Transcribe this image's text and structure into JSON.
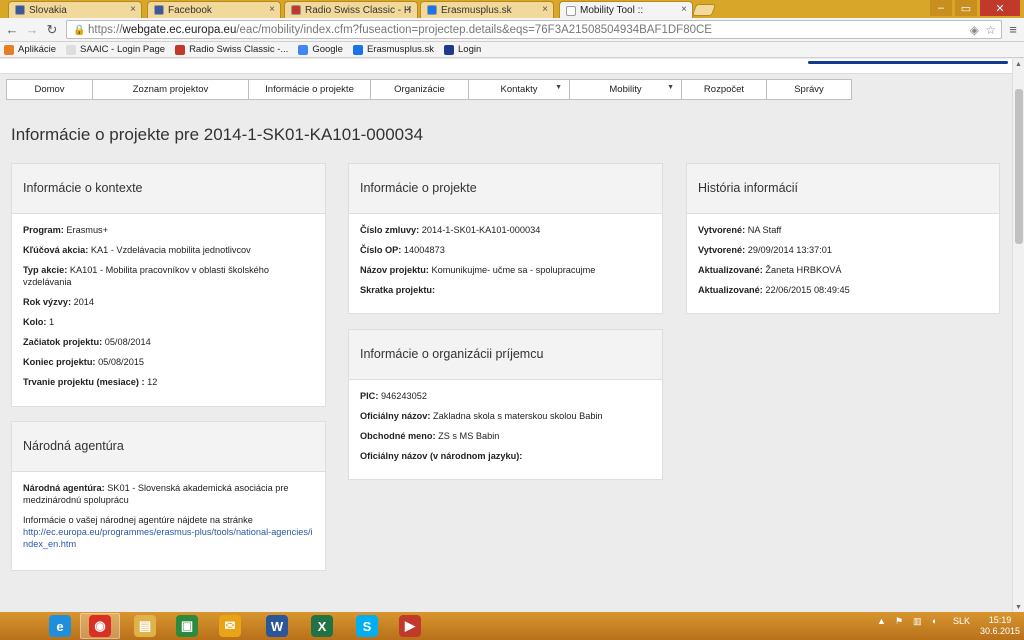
{
  "tabs": [
    {
      "label": "Slovakia",
      "color": "#3b5998"
    },
    {
      "label": "Facebook",
      "color": "#3b5998"
    },
    {
      "label": "Radio Swiss Classic - H",
      "color": "#c0392b"
    },
    {
      "label": "Erasmusplus.sk",
      "color": "#1a73e8"
    },
    {
      "label": "Mobility Tool ::",
      "color": "#ffffff"
    }
  ],
  "address": {
    "scheme": "https://",
    "host": "webgate.ec.europa.eu",
    "path": "/eac/mobility/index.cfm?fuseaction=projectep.details&eqs=76F3A21508504934BAF1DF80CE"
  },
  "bookmarks": [
    {
      "label": "Aplikácie",
      "icon": "apps-icon",
      "color": "#e67e22"
    },
    {
      "label": "SAAIC - Login Page",
      "icon": "page-icon",
      "color": "#dddddd"
    },
    {
      "label": "Radio Swiss Classic -...",
      "icon": "radio-icon",
      "color": "#c0392b"
    },
    {
      "label": "Google",
      "icon": "google-icon",
      "color": "#4285f4"
    },
    {
      "label": "Erasmusplus.sk",
      "icon": "erasmus-icon",
      "color": "#1a73e8"
    },
    {
      "label": "Login",
      "icon": "eu-icon",
      "color": "#1e3a8a"
    }
  ],
  "menu": [
    {
      "label": "Domov",
      "dropdown": false
    },
    {
      "label": "Zoznam projektov",
      "dropdown": false
    },
    {
      "label": "Informácie o projekte",
      "dropdown": false
    },
    {
      "label": "Organizácie",
      "dropdown": false
    },
    {
      "label": "Kontakty",
      "dropdown": true
    },
    {
      "label": "Mobility",
      "dropdown": true
    },
    {
      "label": "Rozpočet",
      "dropdown": false
    },
    {
      "label": "Správy",
      "dropdown": false
    }
  ],
  "page_title": "Informácie o projekte pre 2014-1-SK01-KA101-000034",
  "context": {
    "title": "Informácie o kontexte",
    "rows": [
      {
        "label": "Program:",
        "value": "Erasmus+"
      },
      {
        "label": "Kľúčová akcia:",
        "value": "KA1 - Vzdelávacia mobilita jednotlivcov"
      },
      {
        "label": "Typ akcie:",
        "value": "KA101 - Mobilita pracovníkov v oblasti školského vzdelávania"
      },
      {
        "label": "Rok výzvy:",
        "value": "2014"
      },
      {
        "label": "Kolo:",
        "value": "1"
      },
      {
        "label": "Začiatok projektu:",
        "value": "05/08/2014"
      },
      {
        "label": "Koniec projektu:",
        "value": "05/08/2015"
      },
      {
        "label": "Trvanie projektu (mesiace) :",
        "value": "12"
      }
    ]
  },
  "agency": {
    "title": "Národná agentúra",
    "label": "Národná agentúra:",
    "value": "SK01 - Slovenská akademická asociácia pre medzinárodnú spoluprácu",
    "info": "Informácie o vašej národnej agentúre nájdete na stránke",
    "link": "http://ec.europa.eu/programmes/erasmus-plus/tools/national-agencies/index_en.htm"
  },
  "project": {
    "title": "Informácie o projekte",
    "rows": [
      {
        "label": "Číslo zmluvy:",
        "value": "2014-1-SK01-KA101-000034"
      },
      {
        "label": "Číslo OP:",
        "value": "14004873"
      },
      {
        "label": "Názov projektu:",
        "value": "Komunikujme- učme sa - spolupracujme"
      },
      {
        "label": "Skratka projektu:",
        "value": ""
      }
    ]
  },
  "organization": {
    "title": "Informácie o organizácii príjemcu",
    "rows": [
      {
        "label": "PIC:",
        "value": "946243052"
      },
      {
        "label": "Oficiálny názov:",
        "value": "Zakladna skola s materskou skolou Babin"
      },
      {
        "label": "Obchodné meno:",
        "value": "ZS s MS Babin"
      },
      {
        "label": "Oficiálny názov (v národnom jazyku):",
        "value": ""
      }
    ]
  },
  "history": {
    "title": "História informácií",
    "rows": [
      {
        "label": "Vytvorené:",
        "value": "NA Staff"
      },
      {
        "label": "Vytvorené:",
        "value": "29/09/2014 13:37:01"
      },
      {
        "label": "Aktualizované:",
        "value": "Žaneta HRBKOVÁ"
      },
      {
        "label": "Aktualizované:",
        "value": "22/06/2015 08:49:45"
      }
    ]
  },
  "taskbar": {
    "apps": [
      {
        "name": "ie-icon",
        "glyph": "e",
        "color": "#1f8fdc"
      },
      {
        "name": "chrome-icon",
        "glyph": "◉",
        "color": "#d93025"
      },
      {
        "name": "explorer-icon",
        "glyph": "▤",
        "color": "#e0b24a"
      },
      {
        "name": "store-icon",
        "glyph": "▣",
        "color": "#2b8a3e"
      },
      {
        "name": "outlook-icon",
        "glyph": "✉",
        "color": "#e8a317"
      },
      {
        "name": "word-icon",
        "glyph": "W",
        "color": "#2b579a"
      },
      {
        "name": "excel-icon",
        "glyph": "X",
        "color": "#217346"
      },
      {
        "name": "skype-icon",
        "glyph": "S",
        "color": "#00aff0"
      },
      {
        "name": "media-icon",
        "glyph": "▶",
        "color": "#c0392b"
      }
    ],
    "lang": "SLK",
    "time": "15:19",
    "date": "30.6.2015"
  }
}
